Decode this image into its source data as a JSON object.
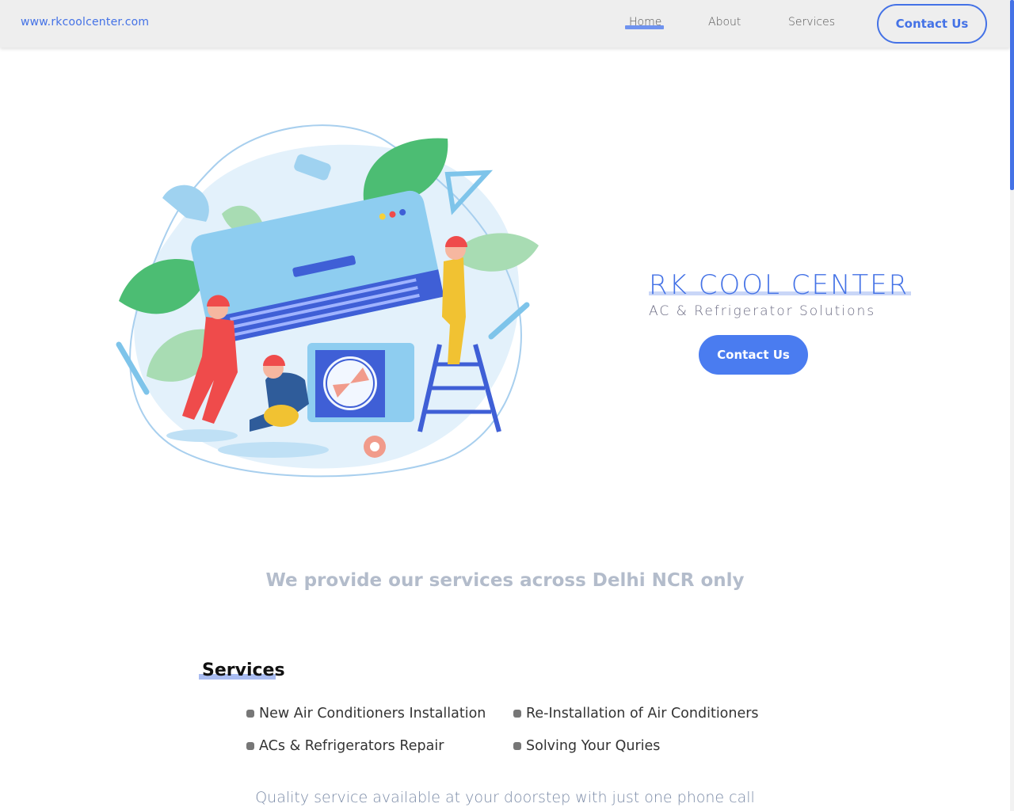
{
  "header": {
    "brand_url": "www.rkcoolcenter.com",
    "nav": {
      "home": "Home",
      "about": "About",
      "services": "Services",
      "contact": "Contact Us"
    }
  },
  "hero": {
    "title": "RK COOL CENTER",
    "subtitle": "AC & Refrigerator Solutions",
    "contact_button": "Contact Us"
  },
  "coverage": "We provide our services across Delhi NCR only",
  "services": {
    "heading": "Services",
    "items": [
      "New Air Conditioners Installation",
      "Re-Installation of Air Conditioners",
      "ACs & Refrigerators Repair",
      "Solving Your Quries"
    ]
  },
  "tagline": "Quality service available at your doorstep with just one phone call",
  "colors": {
    "accent": "#4472e6",
    "nav_background": "#eeeeee",
    "coverage_text": "#b3bccb"
  }
}
